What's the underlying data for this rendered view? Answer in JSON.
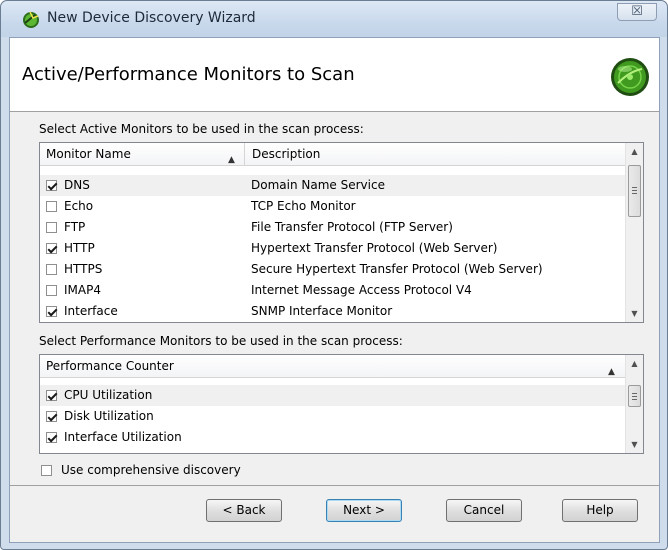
{
  "window": {
    "title": "New Device Discovery Wizard",
    "close_glyph": "☒"
  },
  "header": {
    "page_title": "Active/Performance Monitors to Scan",
    "icon": "globe-icon"
  },
  "active": {
    "label": "Select Active Monitors to be used in the scan process:",
    "columns": [
      "Monitor Name",
      "Description"
    ],
    "rows": [
      {
        "name": "DNS",
        "description": "Domain Name Service",
        "checked": true
      },
      {
        "name": "Echo",
        "description": "TCP Echo Monitor",
        "checked": false
      },
      {
        "name": "FTP",
        "description": "File Transfer Protocol (FTP Server)",
        "checked": false
      },
      {
        "name": "HTTP",
        "description": "Hypertext Transfer Protocol (Web Server)",
        "checked": true
      },
      {
        "name": "HTTPS",
        "description": "Secure Hypertext Transfer Protocol (Web Server)",
        "checked": false
      },
      {
        "name": "IMAP4",
        "description": "Internet Message Access Protocol V4",
        "checked": false
      },
      {
        "name": "Interface",
        "description": "SNMP Interface Monitor",
        "checked": true
      }
    ]
  },
  "performance": {
    "label": "Select Performance Monitors to be used in the scan process:",
    "column": "Performance Counter",
    "rows": [
      {
        "name": "CPU Utilization",
        "checked": true
      },
      {
        "name": "Disk Utilization",
        "checked": true
      },
      {
        "name": "Interface Utilization",
        "checked": true
      }
    ]
  },
  "comprehensive": {
    "label": "Use comprehensive discovery",
    "checked": false
  },
  "buttons": {
    "back": "< Back",
    "next": "Next >",
    "cancel": "Cancel",
    "help": "Help"
  },
  "colors": {
    "frame": "#cfdcec",
    "selection_row": "#f0f0f0",
    "globe": "#3f9a1f"
  }
}
